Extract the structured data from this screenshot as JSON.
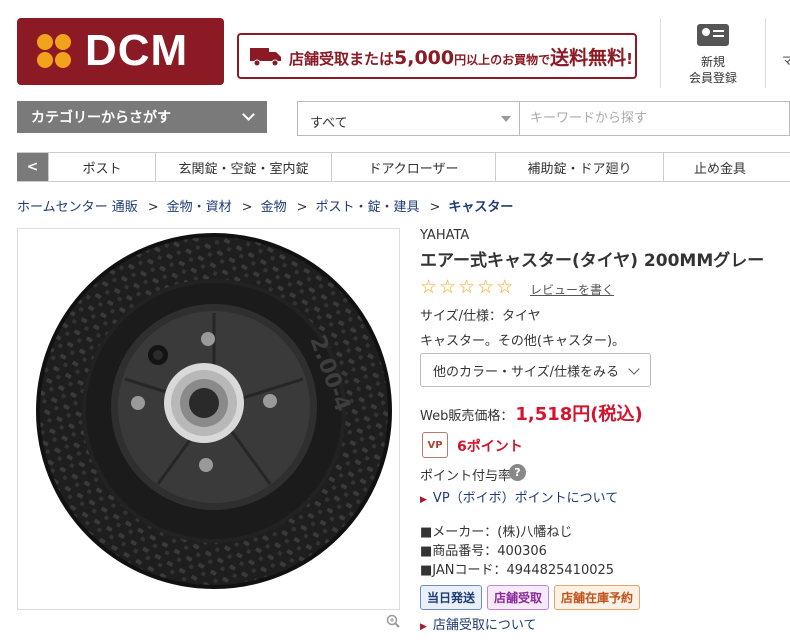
{
  "header": {
    "logo_text": "DCM",
    "banner": {
      "part1": "店舗受取または",
      "amount": "5,000",
      "part2": "円以上のお買物で",
      "part3": "送料無料",
      "part4": "!"
    },
    "member": {
      "line1": "新規",
      "line2": "会員登録"
    },
    "edge_char": "マ"
  },
  "search": {
    "category_button": "カテゴリーからさがす",
    "scope": "すべて",
    "placeholder": "キーワードから探す"
  },
  "nav": {
    "prev": "<",
    "items": [
      "ポスト",
      "玄関錠・空錠・室内錠",
      "ドアクローザー",
      "補助錠・ドア廻り",
      "止め金具"
    ]
  },
  "breadcrumb": [
    "ホームセンター 通販",
    "金物・資材",
    "金物",
    "ポスト・錠・建具",
    "キャスター"
  ],
  "product": {
    "brand": "YAHATA",
    "title": "エアー式キャスター(タイヤ) 200MMグレー",
    "rating_stars": 0,
    "review_link": "レビューを書く",
    "spec": "サイズ/仕様：タイヤ",
    "description": "キャスター。その他(キャスター)。",
    "variant_button": "他のカラー・サイズ/仕様をみる",
    "price_label": "Web販売価格：",
    "price": "1,518円(税込)",
    "vp_badge": "VP",
    "points": "6ポイント",
    "points_rate_label": "ポイント付与率",
    "points_help": "?",
    "vp_link": "VP（ボイボ）ポイントについて",
    "maker": "■メーカー：(株)八幡ねじ",
    "product_no": "■商品番号：400306",
    "jan": "■JANコード：4944825410025",
    "tags": [
      {
        "label": "当日発送",
        "color": "#1f3b73",
        "bg": "#e9f0fb",
        "border": "#6c8cc6"
      },
      {
        "label": "店舗受取",
        "color": "#8a2a9a",
        "bg": "#f6eafa",
        "border": "#c08ad0"
      },
      {
        "label": "店舗在庫予約",
        "color": "#c0531a",
        "bg": "#fdf0e4",
        "border": "#e8a46a"
      }
    ],
    "pickup_link": "店舗受取について",
    "tire_text": "2.00-4"
  },
  "colors": {
    "brand": "#8b1a24",
    "logo_dots": "#f2a31b",
    "price": "#d4142e",
    "link": "#1f3b73",
    "nav_dark": "#7a7a7a"
  }
}
